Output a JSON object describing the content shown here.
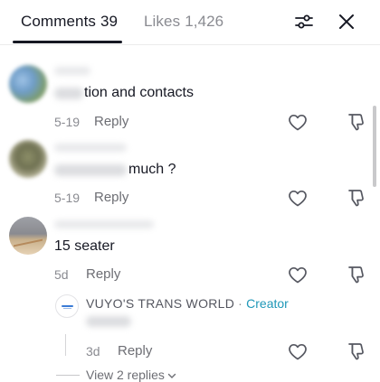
{
  "header": {
    "tabs": [
      {
        "label": "Comments",
        "count": "39",
        "active": true
      },
      {
        "label": "Likes",
        "count": "1,426",
        "active": false
      }
    ],
    "filter_icon": "sliders-icon",
    "close_icon": "close-icon"
  },
  "comments": [
    {
      "text": "tion and contacts",
      "date": "5-19",
      "reply_label": "Reply",
      "avatar": "blurred-photo",
      "username_blurred": true
    },
    {
      "text": "much ?",
      "date": "5-19",
      "reply_label": "Reply",
      "avatar": "blurred-photo",
      "username_blurred": true
    },
    {
      "text": "15 seater",
      "date": "5d",
      "reply_label": "Reply",
      "avatar": "house-photo",
      "username_blurred": true,
      "replies": [
        {
          "author": "VUYO'S TRANS WORLD",
          "separator": "·",
          "badge": "Creator",
          "date": "3d",
          "reply_label": "Reply",
          "text_blurred": true
        }
      ],
      "view_replies_label": "View 2 replies"
    }
  ],
  "colors": {
    "text": "#161823",
    "muted": "#8a8b91",
    "creator_badge": "#1f98b8",
    "background": "#ffffff"
  }
}
